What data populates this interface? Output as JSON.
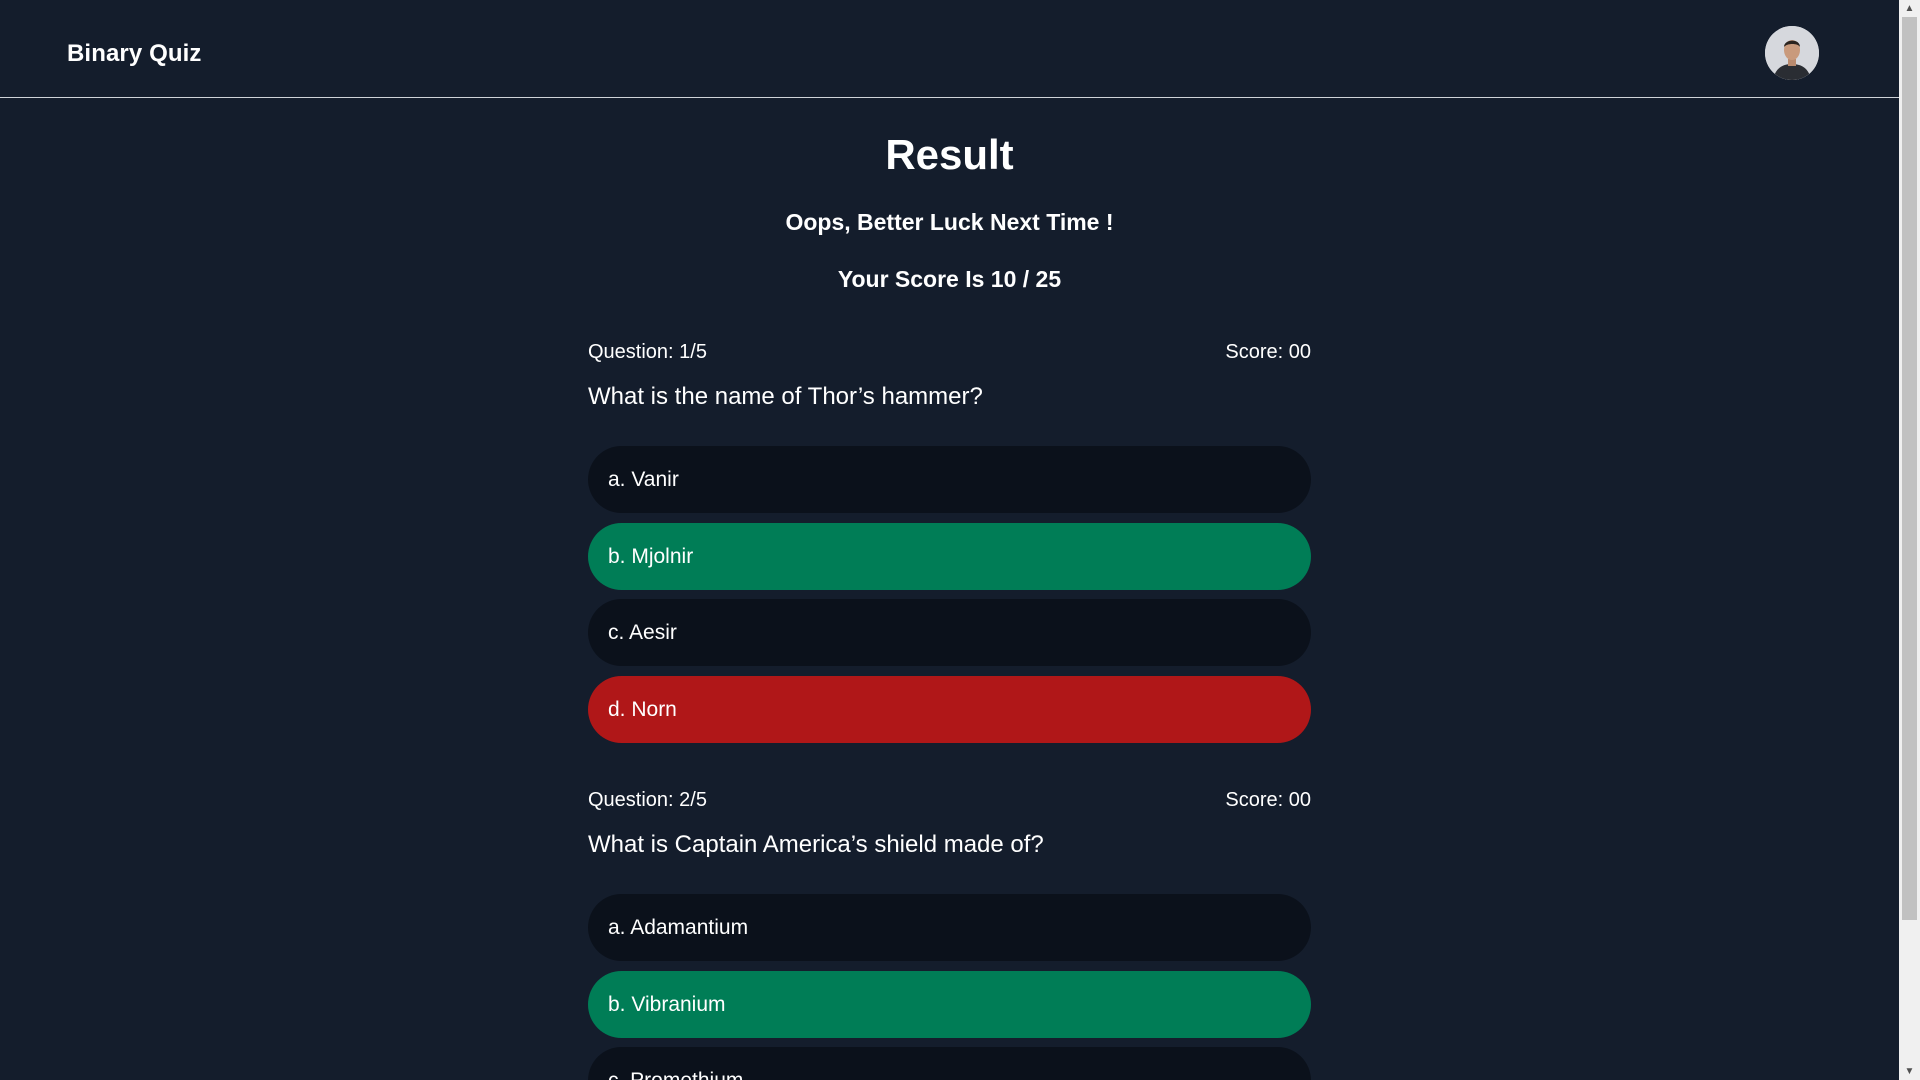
{
  "header": {
    "brand": "Binary Quiz",
    "avatar_icon": "user-avatar"
  },
  "result": {
    "title": "Result",
    "message": "Oops, Better Luck Next Time !",
    "score_text": "Your Score Is 10 / 25"
  },
  "questions": [
    {
      "number_label": "Question: 1/5",
      "score_label": "Score: 00",
      "text": "What is the name of Thor’s hammer?",
      "options": [
        {
          "label": "a. Vanir",
          "state": "neutral"
        },
        {
          "label": "b. Mjolnir",
          "state": "correct"
        },
        {
          "label": "c. Aesir",
          "state": "neutral"
        },
        {
          "label": "d. Norn",
          "state": "wrong"
        }
      ]
    },
    {
      "number_label": "Question: 2/5",
      "score_label": "Score: 00",
      "text": "What is Captain America’s shield made of?",
      "options": [
        {
          "label": "a. Adamantium",
          "state": "neutral"
        },
        {
          "label": "b. Vibranium",
          "state": "correct"
        },
        {
          "label": "c. Promethium",
          "state": "neutral"
        }
      ]
    }
  ],
  "colors": {
    "background": "#141d2c",
    "option_default": "#0b111b",
    "option_correct": "#007d56",
    "option_wrong": "#b01718"
  }
}
